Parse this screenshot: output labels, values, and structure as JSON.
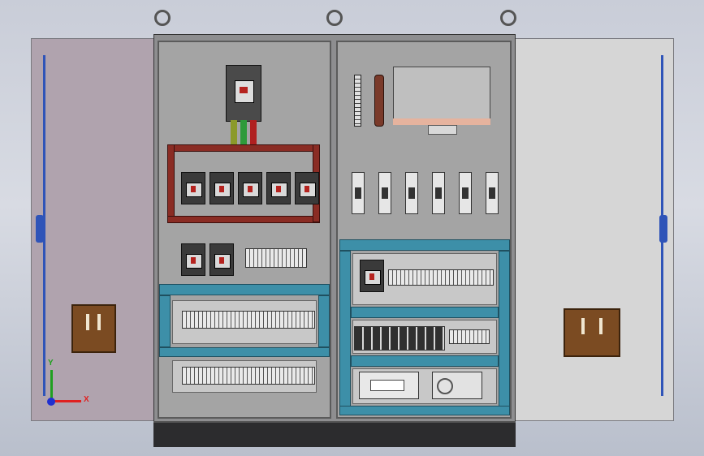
{
  "viewport": {
    "background": "#c9cdd8"
  },
  "colors": {
    "busbar": "#8a2c24",
    "cable_duct": "#3d8fa8",
    "hinge_rod": "#2f54b8",
    "handle": "#7b4b22",
    "left_door": "#b0a3ae",
    "right_door": "#d6d6d6",
    "plinth": "#2c2c2e"
  },
  "axis_triad": {
    "x_label": "X",
    "y_label": "Y",
    "x_color": "#e02020",
    "y_color": "#20a020",
    "z_color": "#2030d0"
  },
  "icons": [
    "lifting-eye-icon",
    "door-handle-icon",
    "axis-triad-icon"
  ]
}
